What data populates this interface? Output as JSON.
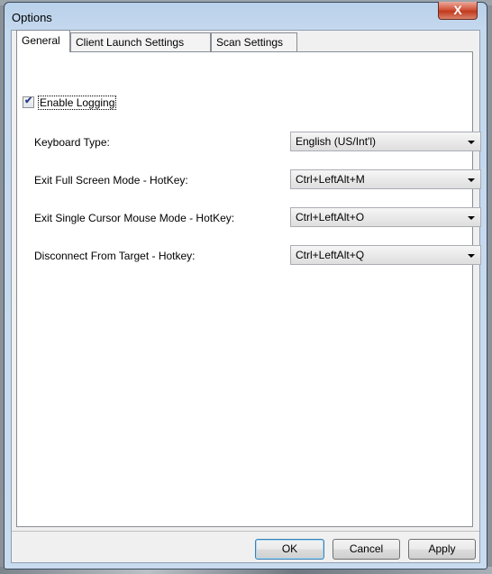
{
  "window": {
    "title": "Options",
    "close_glyph": "X"
  },
  "tabs": [
    {
      "label": "General",
      "active": true
    },
    {
      "label": "Client Launch Settings",
      "active": false
    },
    {
      "label": "Scan Settings",
      "active": false
    }
  ],
  "general": {
    "enable_logging": {
      "label": "Enable Logging",
      "checked": true
    },
    "rows": [
      {
        "label": "Keyboard Type:",
        "value": "English (US/Int'l)"
      },
      {
        "label": "Exit Full Screen Mode - HotKey:",
        "value": "Ctrl+LeftAlt+M"
      },
      {
        "label": "Exit Single Cursor Mouse Mode - HotKey:",
        "value": "Ctrl+LeftAlt+O"
      },
      {
        "label": "Disconnect From Target - Hotkey:",
        "value": "Ctrl+LeftAlt+Q"
      }
    ]
  },
  "buttons": {
    "ok": "OK",
    "cancel": "Cancel",
    "apply": "Apply"
  },
  "colors": {
    "close_button": "#c9442a",
    "accent_border": "#3c7fb1"
  }
}
